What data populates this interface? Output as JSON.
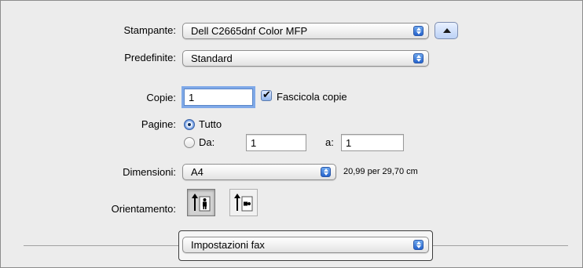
{
  "printer": {
    "label": "Stampante:",
    "value": "Dell C2665dnf Color MFP"
  },
  "presets": {
    "label": "Predefinite:",
    "value": "Standard"
  },
  "copies": {
    "label": "Copie:",
    "value": "1",
    "collate_label": "Fascicola copie"
  },
  "pages": {
    "label": "Pagine:",
    "all_label": "Tutto",
    "range_label": "Da:",
    "from_value": "1",
    "to_label": "a:",
    "to_value": "1"
  },
  "paper": {
    "label": "Dimensioni:",
    "value": "A4",
    "size_text": "20,99 per 29,70 cm"
  },
  "orientation": {
    "label": "Orientamento:"
  },
  "section": {
    "value": "Impostazioni fax"
  }
}
